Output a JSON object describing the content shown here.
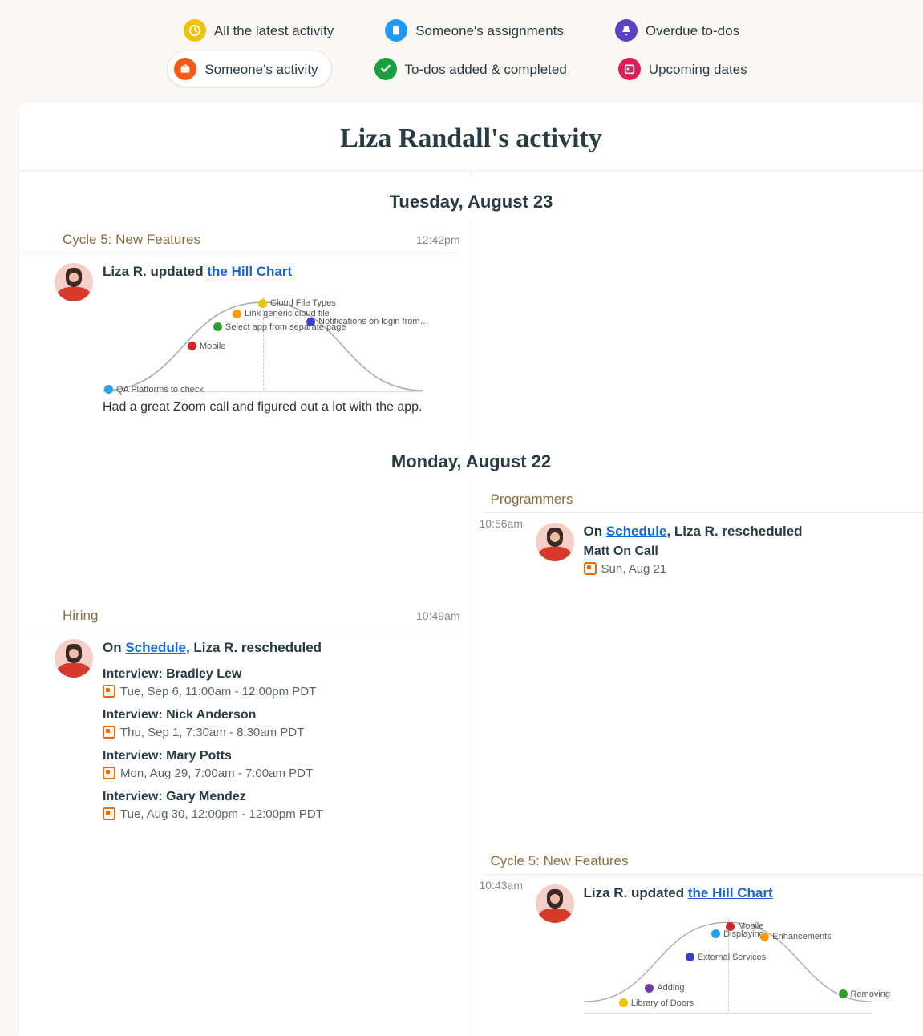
{
  "nav": {
    "row1": [
      {
        "label": "All the latest activity",
        "color": "#f2c200",
        "icon": "clock"
      },
      {
        "label": "Someone's assignments",
        "color": "#1f9bf3",
        "icon": "clipboard"
      },
      {
        "label": "Overdue to-dos",
        "color": "#5843c4",
        "icon": "bell"
      }
    ],
    "row2": [
      {
        "label": "Someone's activity",
        "color": "#f55b14",
        "icon": "briefcase",
        "selected": true
      },
      {
        "label": "To-dos added & completed",
        "color": "#1b9e3e",
        "icon": "check"
      },
      {
        "label": "Upcoming dates",
        "color": "#e01b5c",
        "icon": "calendar"
      }
    ]
  },
  "page_title": "Liza Randall's activity",
  "days": [
    {
      "date_label": "Tuesday, August 23"
    },
    {
      "date_label": "Monday, August 22"
    }
  ],
  "cycle5_tuesday": {
    "section_title": "Cycle 5: New Features",
    "time": "12:42pm",
    "actor": "Liza R.",
    "verb": "updated",
    "link": "the Hill Chart",
    "note": "Had a great Zoom call and figured out a lot with the app.",
    "chart_data": {
      "type": "hill",
      "title": "",
      "points": [
        {
          "label": "QA Platforms to check",
          "color": "#2aa0ea",
          "x": 0.02,
          "y": 0.01
        },
        {
          "label": "Mobile",
          "color": "#d62728",
          "x": 0.28,
          "y": 0.5
        },
        {
          "label": "Select app from separate page",
          "color": "#2ca02c",
          "x": 0.36,
          "y": 0.72
        },
        {
          "label": "Link generic cloud file",
          "color": "#f5a000",
          "x": 0.42,
          "y": 0.87
        },
        {
          "label": "Cloud File Types",
          "color": "#f2c200",
          "x": 0.5,
          "y": 0.99
        },
        {
          "label": "Notifications on login from…",
          "color": "#3c40c6",
          "x": 0.65,
          "y": 0.78
        }
      ]
    }
  },
  "programmers_monday": {
    "section_title": "Programmers",
    "time": "10:56am",
    "prefix": "On",
    "link": "Schedule",
    "suffix": ", Liza R. rescheduled",
    "event_title": "Matt On Call",
    "event_date": "Sun, Aug 21"
  },
  "hiring_monday": {
    "section_title": "Hiring",
    "time": "10:49am",
    "prefix": "On",
    "link": "Schedule",
    "suffix": ", Liza R. rescheduled",
    "events": [
      {
        "title": "Interview: Bradley Lew",
        "date": "Tue, Sep 6, 11:00am - 12:00pm PDT"
      },
      {
        "title": "Interview: Nick Anderson",
        "date": "Thu, Sep 1, 7:30am - 8:30am PDT"
      },
      {
        "title": "Interview: Mary Potts",
        "date": "Mon, Aug 29, 7:00am - 7:00am PDT"
      },
      {
        "title": "Interview: Gary Mendez",
        "date": "Tue, Aug 30, 12:00pm - 12:00pm PDT"
      }
    ]
  },
  "cycle5_monday": {
    "section_title": "Cycle 5: New Features",
    "time": "10:43am",
    "actor": "Liza R.",
    "verb": "updated",
    "link": "the Hill Chart",
    "chart_data": {
      "type": "hill",
      "points": [
        {
          "label": "Library of Doors",
          "color": "#f2c200",
          "x": 0.14,
          "y": 0.1
        },
        {
          "label": "Adding",
          "color": "#6a3da3",
          "x": 0.23,
          "y": 0.27
        },
        {
          "label": "External Services",
          "color": "#3c40c6",
          "x": 0.37,
          "y": 0.62
        },
        {
          "label": "Displaying",
          "color": "#2aa0ea",
          "x": 0.46,
          "y": 0.88
        },
        {
          "label": "Mobile",
          "color": "#d62728",
          "x": 0.51,
          "y": 0.97
        },
        {
          "label": "Enhancements",
          "color": "#f5a000",
          "x": 0.63,
          "y": 0.85
        },
        {
          "label": "Removing",
          "color": "#2ca02c",
          "x": 0.9,
          "y": 0.2
        }
      ]
    }
  }
}
